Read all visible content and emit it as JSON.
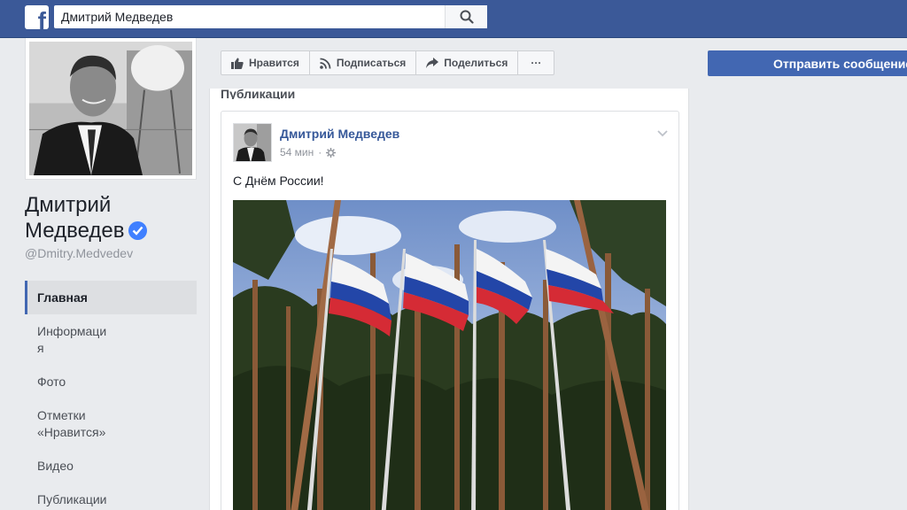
{
  "header": {
    "logo": "f",
    "search_value": "Дмитрий Медведев",
    "search_icon": "search-icon"
  },
  "page": {
    "name_line1": "Дмитрий",
    "name_line2": "Медведев",
    "handle": "@Dmitry.Medvedev",
    "verified": true
  },
  "nav": {
    "items": [
      {
        "label": "Главная",
        "active": true
      },
      {
        "label": "Информаци\nя",
        "active": false
      },
      {
        "label": "Фото",
        "active": false
      },
      {
        "label": "Отметки «Нравится»",
        "active": false
      },
      {
        "label": "Видео",
        "active": false
      },
      {
        "label": "Публикации",
        "active": false
      }
    ]
  },
  "actions": {
    "like": "Нравится",
    "follow": "Подписаться",
    "share": "Поделиться",
    "more": "···"
  },
  "send_message": "Отправить сообщение",
  "publications": {
    "title": "Публикации",
    "post": {
      "author": "Дмитрий Медведев",
      "time": "54 мин",
      "text": "С Днём России!"
    }
  },
  "colors": {
    "topbar": "#3b5998",
    "link": "#365899",
    "primary_button": "#4267b2"
  }
}
